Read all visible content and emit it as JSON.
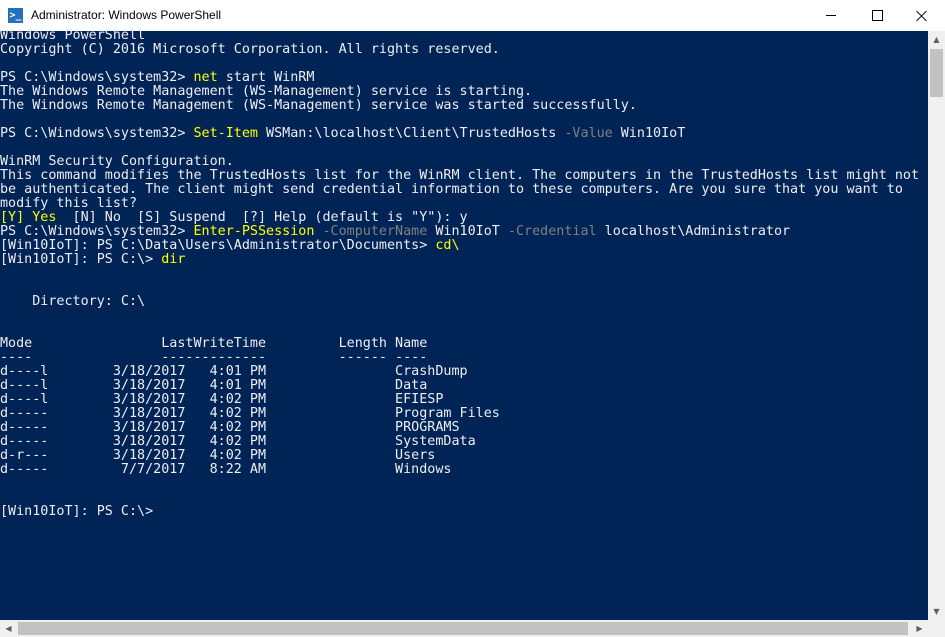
{
  "window": {
    "title": "Administrator: Windows PowerShell",
    "icon": "powershell-icon",
    "icon_glyph": ">_"
  },
  "colors": {
    "console_bg": "#012456",
    "console_fg": "#eeedf0",
    "command": "#ffff00",
    "parameter": "#808080"
  },
  "console": {
    "lines": [
      [
        {
          "t": "Windows PowerShell"
        }
      ],
      [
        {
          "t": "Copyright (C) 2016 Microsoft Corporation. All rights reserved."
        }
      ],
      [
        {
          "t": ""
        }
      ],
      [
        {
          "t": "PS C:\\Windows\\system32> "
        },
        {
          "t": "net",
          "c": "cmd"
        },
        {
          "t": " start WinRM"
        }
      ],
      [
        {
          "t": "The Windows Remote Management (WS-Management) service is starting."
        }
      ],
      [
        {
          "t": "The Windows Remote Management (WS-Management) service was started successfully."
        }
      ],
      [
        {
          "t": ""
        }
      ],
      [
        {
          "t": "PS C:\\Windows\\system32> "
        },
        {
          "t": "Set-Item",
          "c": "cmd"
        },
        {
          "t": " WSMan:\\localhost\\Client\\TrustedHosts "
        },
        {
          "t": "-Value",
          "c": "param"
        },
        {
          "t": " Win10IoT"
        }
      ],
      [
        {
          "t": ""
        }
      ],
      [
        {
          "t": "WinRM Security Configuration."
        }
      ],
      [
        {
          "t": "This command modifies the TrustedHosts list for the WinRM client. The computers in the TrustedHosts list might not"
        }
      ],
      [
        {
          "t": "be authenticated. The client might send credential information to these computers. Are you sure that you want to"
        }
      ],
      [
        {
          "t": "modify this list?"
        }
      ],
      [
        {
          "t": "[Y] Yes",
          "c": "cmd"
        },
        {
          "t": "  [N] No  [S] Suspend  [?] Help (default is \"Y\"): y"
        }
      ],
      [
        {
          "t": "PS C:\\Windows\\system32> "
        },
        {
          "t": "Enter-PSSession",
          "c": "cmd"
        },
        {
          "t": " "
        },
        {
          "t": "-ComputerName",
          "c": "param"
        },
        {
          "t": " Win10IoT "
        },
        {
          "t": "-Credential",
          "c": "param"
        },
        {
          "t": " localhost\\Administrator"
        }
      ],
      [
        {
          "t": "[Win10IoT]: PS C:\\Data\\Users\\Administrator\\Documents> "
        },
        {
          "t": "cd\\",
          "c": "cmd"
        }
      ],
      [
        {
          "t": "[Win10IoT]: PS C:\\> "
        },
        {
          "t": "dir",
          "c": "cmd"
        }
      ],
      [
        {
          "t": ""
        }
      ],
      [
        {
          "t": ""
        }
      ],
      [
        {
          "t": "    Directory: C:\\"
        }
      ],
      [
        {
          "t": ""
        }
      ],
      [
        {
          "t": ""
        }
      ],
      [
        {
          "t": "Mode                LastWriteTime         Length Name"
        }
      ],
      [
        {
          "t": "----                -------------         ------ ----"
        }
      ],
      [
        {
          "t": "d----l        3/18/2017   4:01 PM                CrashDump"
        }
      ],
      [
        {
          "t": "d----l        3/18/2017   4:01 PM                Data"
        }
      ],
      [
        {
          "t": "d----l        3/18/2017   4:02 PM                EFIESP"
        }
      ],
      [
        {
          "t": "d-----        3/18/2017   4:02 PM                Program Files"
        }
      ],
      [
        {
          "t": "d-----        3/18/2017   4:02 PM                PROGRAMS"
        }
      ],
      [
        {
          "t": "d-----        3/18/2017   4:02 PM                SystemData"
        }
      ],
      [
        {
          "t": "d-r---        3/18/2017   4:02 PM                Users"
        }
      ],
      [
        {
          "t": "d-----         7/7/2017   8:22 AM                Windows"
        }
      ],
      [
        {
          "t": ""
        }
      ],
      [
        {
          "t": ""
        }
      ],
      [
        {
          "t": "[Win10IoT]: PS C:\\>"
        }
      ]
    ]
  },
  "scrollbars": {
    "up_glyph": "▲",
    "down_glyph": "▼",
    "left_glyph": "◀",
    "right_glyph": "▶"
  }
}
